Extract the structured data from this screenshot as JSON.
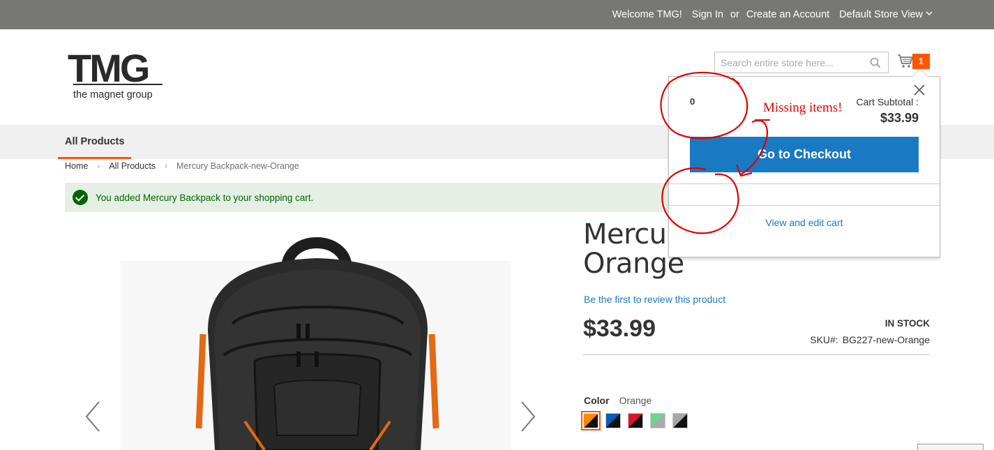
{
  "topbar": {
    "welcome": "Welcome TMG!",
    "sign_in": "Sign In",
    "or": "or",
    "create_account": "Create an Account",
    "store_view": "Default Store View"
  },
  "logo": {
    "word": "TMG",
    "tagline": "the magnet group"
  },
  "search": {
    "placeholder": "Search entire store here..."
  },
  "cart": {
    "count": "1"
  },
  "nav": {
    "items": [
      {
        "label": "All Products"
      }
    ]
  },
  "breadcrumb": {
    "items": [
      "Home",
      "All Products",
      "Mercury Backpack-new-Orange"
    ]
  },
  "message": {
    "text": "You added Mercury Backpack to your shopping cart."
  },
  "product": {
    "title_line1": "Mercur",
    "title_line2": "Orange",
    "review_link": "Be the first to review this product",
    "price": "$33.99",
    "stock": "IN STOCK",
    "sku_label": "SKU#:",
    "sku": "BG227-new-Orange",
    "color_label": "Color",
    "color_value": "Orange",
    "swatches": [
      {
        "name": "black-orange",
        "colors": [
          "#ff8a00",
          "#111111"
        ]
      },
      {
        "name": "black-blue",
        "colors": [
          "#0a5bb5",
          "#111111"
        ]
      },
      {
        "name": "black-red",
        "colors": [
          "#e0112f",
          "#111111"
        ]
      },
      {
        "name": "grey-green",
        "colors": [
          "#6fd393",
          "#a9a9a9"
        ]
      },
      {
        "name": "black-grey",
        "colors": [
          "#a6a6a6",
          "#111111"
        ]
      }
    ]
  },
  "minicart": {
    "items_count": "0",
    "subtotal_label": "Cart Subtotal :",
    "subtotal": "$33.99",
    "checkout_label": "Go to Checkout",
    "view_cart": "View and edit cart"
  },
  "annotation": {
    "text": "Missing items!",
    "color": "#e00000"
  },
  "colors": {
    "topbar": "#777775",
    "accent": "#ff5501",
    "link": "#1979c3",
    "success_bg": "#e5efe5",
    "success_text": "#006400"
  }
}
